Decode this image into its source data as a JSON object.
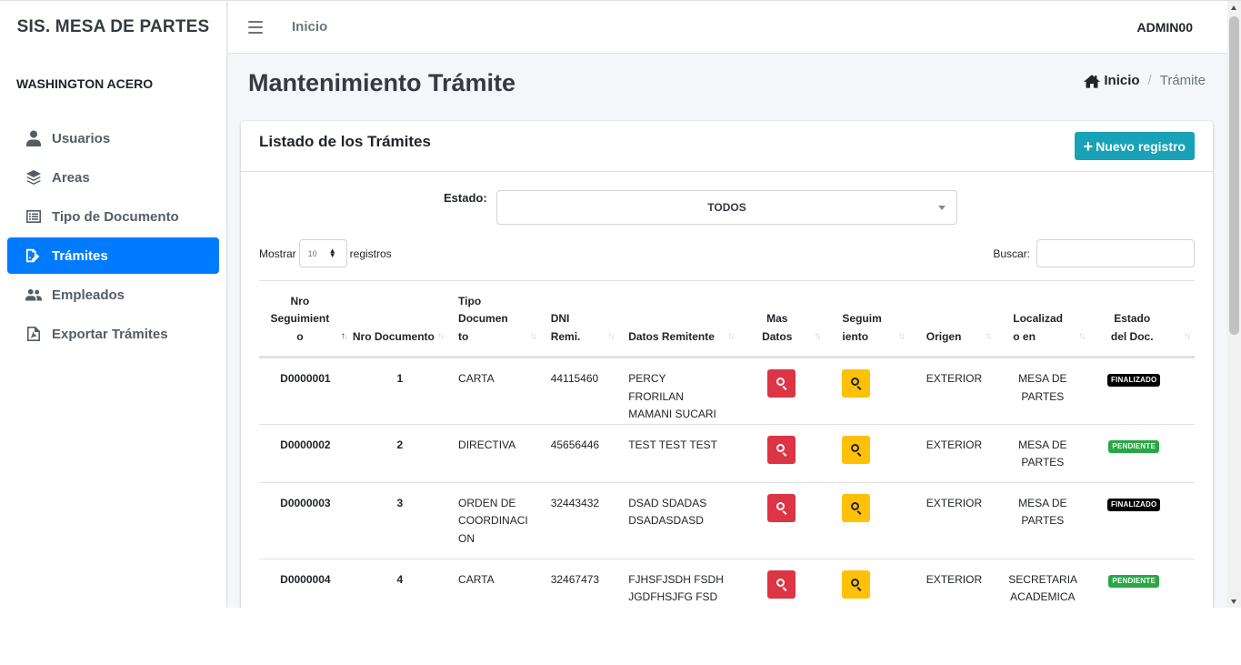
{
  "sidebar": {
    "brand": "SIS. MESA DE PARTES",
    "user_name": "WASHINGTON ACERO",
    "items": [
      {
        "label": "Usuarios",
        "icon": "user-icon"
      },
      {
        "label": "Areas",
        "icon": "layers-icon"
      },
      {
        "label": "Tipo de Documento",
        "icon": "list-alt-icon"
      },
      {
        "label": "Trámites",
        "icon": "file-signature-icon",
        "active": true
      },
      {
        "label": "Empleados",
        "icon": "users-icon"
      },
      {
        "label": "Exportar Trámites",
        "icon": "file-pdf-icon"
      }
    ]
  },
  "topbar": {
    "home_link": "Inicio",
    "user": "ADMIN00"
  },
  "page": {
    "title": "Mantenimiento Trámite",
    "breadcrumb": {
      "home": "Inicio",
      "separator": "/",
      "current": "Trámite"
    }
  },
  "card": {
    "title": "Listado de los Trámites",
    "new_button": "Nuevo registro",
    "new_button_icon": "+",
    "estado_label": "Estado:",
    "estado_value": "TODOS",
    "show_prefix": "Mostrar",
    "show_value": "10",
    "show_suffix": "registros",
    "search_label": "Buscar:",
    "search_value": ""
  },
  "table": {
    "headers": [
      "Nro Seguimient o",
      "Nro Documento",
      "Tipo Documen to",
      "DNI Remi.",
      "Datos Remitente",
      "Mas Datos",
      "Seguim iento",
      "Origen",
      "Localizad o en",
      "Estado del Doc."
    ],
    "rows": [
      {
        "seguimiento": "D0000001",
        "nro": "1",
        "tipo": "CARTA",
        "dni": "44115460",
        "remitente": "PERCY FRORILAN MAMANI SUCARI",
        "origen": "EXTERIOR",
        "localizado": "MESA DE PARTES",
        "estado": "FINALIZADO"
      },
      {
        "seguimiento": "D0000002",
        "nro": "2",
        "tipo": "DIRECTIVA",
        "dni": "45656446",
        "remitente": "TEST TEST TEST",
        "origen": "EXTERIOR",
        "localizado": "MESA DE PARTES",
        "estado": "PENDIENTE"
      },
      {
        "seguimiento": "D0000003",
        "nro": "3",
        "tipo": "ORDEN DE COORDINACI ON",
        "dni": "32443432",
        "remitente": "DSAD SDADAS DSADASDASD",
        "origen": "EXTERIOR",
        "localizado": "MESA DE PARTES",
        "estado": "FINALIZADO"
      },
      {
        "seguimiento": "D0000004",
        "nro": "4",
        "tipo": "CARTA",
        "dni": "32467473",
        "remitente": "FJHSFJSDH FSDHJGDFHSJFG FSDGJHSDGFJSD",
        "origen": "EXTERIOR",
        "localizado": "SECRETARIA ACADEMICA",
        "estado": "PENDIENTE"
      }
    ]
  },
  "colors": {
    "primary": "#007bff",
    "info": "#17a2b8",
    "danger": "#dc3545",
    "warning": "#ffc107",
    "success": "#28a745",
    "dark": "#000000"
  }
}
